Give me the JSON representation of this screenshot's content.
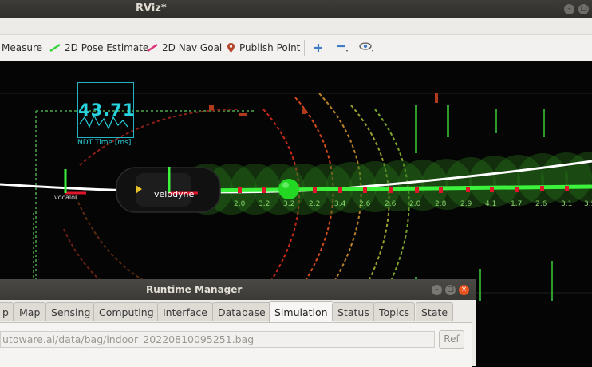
{
  "rviz": {
    "title": "RViz*",
    "toolbar": {
      "measure": "Measure",
      "pose_estimate": "2D Pose Estimate",
      "nav_goal": "2D Nav Goal",
      "publish_point": "Publish Point"
    },
    "viewport": {
      "ndt_time_value": "43.71",
      "ndt_time_label": "NDT Time [ms]",
      "vehicle_label": "velodyne",
      "odom_label": "vocalol",
      "waypoint_speeds": [
        "2.0",
        "3.2",
        "3.2",
        "2.2",
        "3.4",
        "2.6",
        "2.6",
        "2.0",
        "2.8",
        "2.9",
        "4.1",
        "1.7",
        "2.6",
        "3.1",
        "3.5"
      ]
    }
  },
  "runtime_manager": {
    "title": "Runtime Manager",
    "tabs": [
      "p",
      "Map",
      "Sensing",
      "Computing",
      "Interface",
      "Database",
      "Simulation",
      "Status",
      "Topics",
      "State"
    ],
    "active_tab": "Simulation",
    "bag_path": "utoware.ai/data/bag/indoor_20220810095251.bag",
    "ref_button": "Ref"
  },
  "colors": {
    "ndt_cyan": "#28d3de",
    "path_green": "#3cf23c",
    "waypoint_red": "#e0152a"
  }
}
